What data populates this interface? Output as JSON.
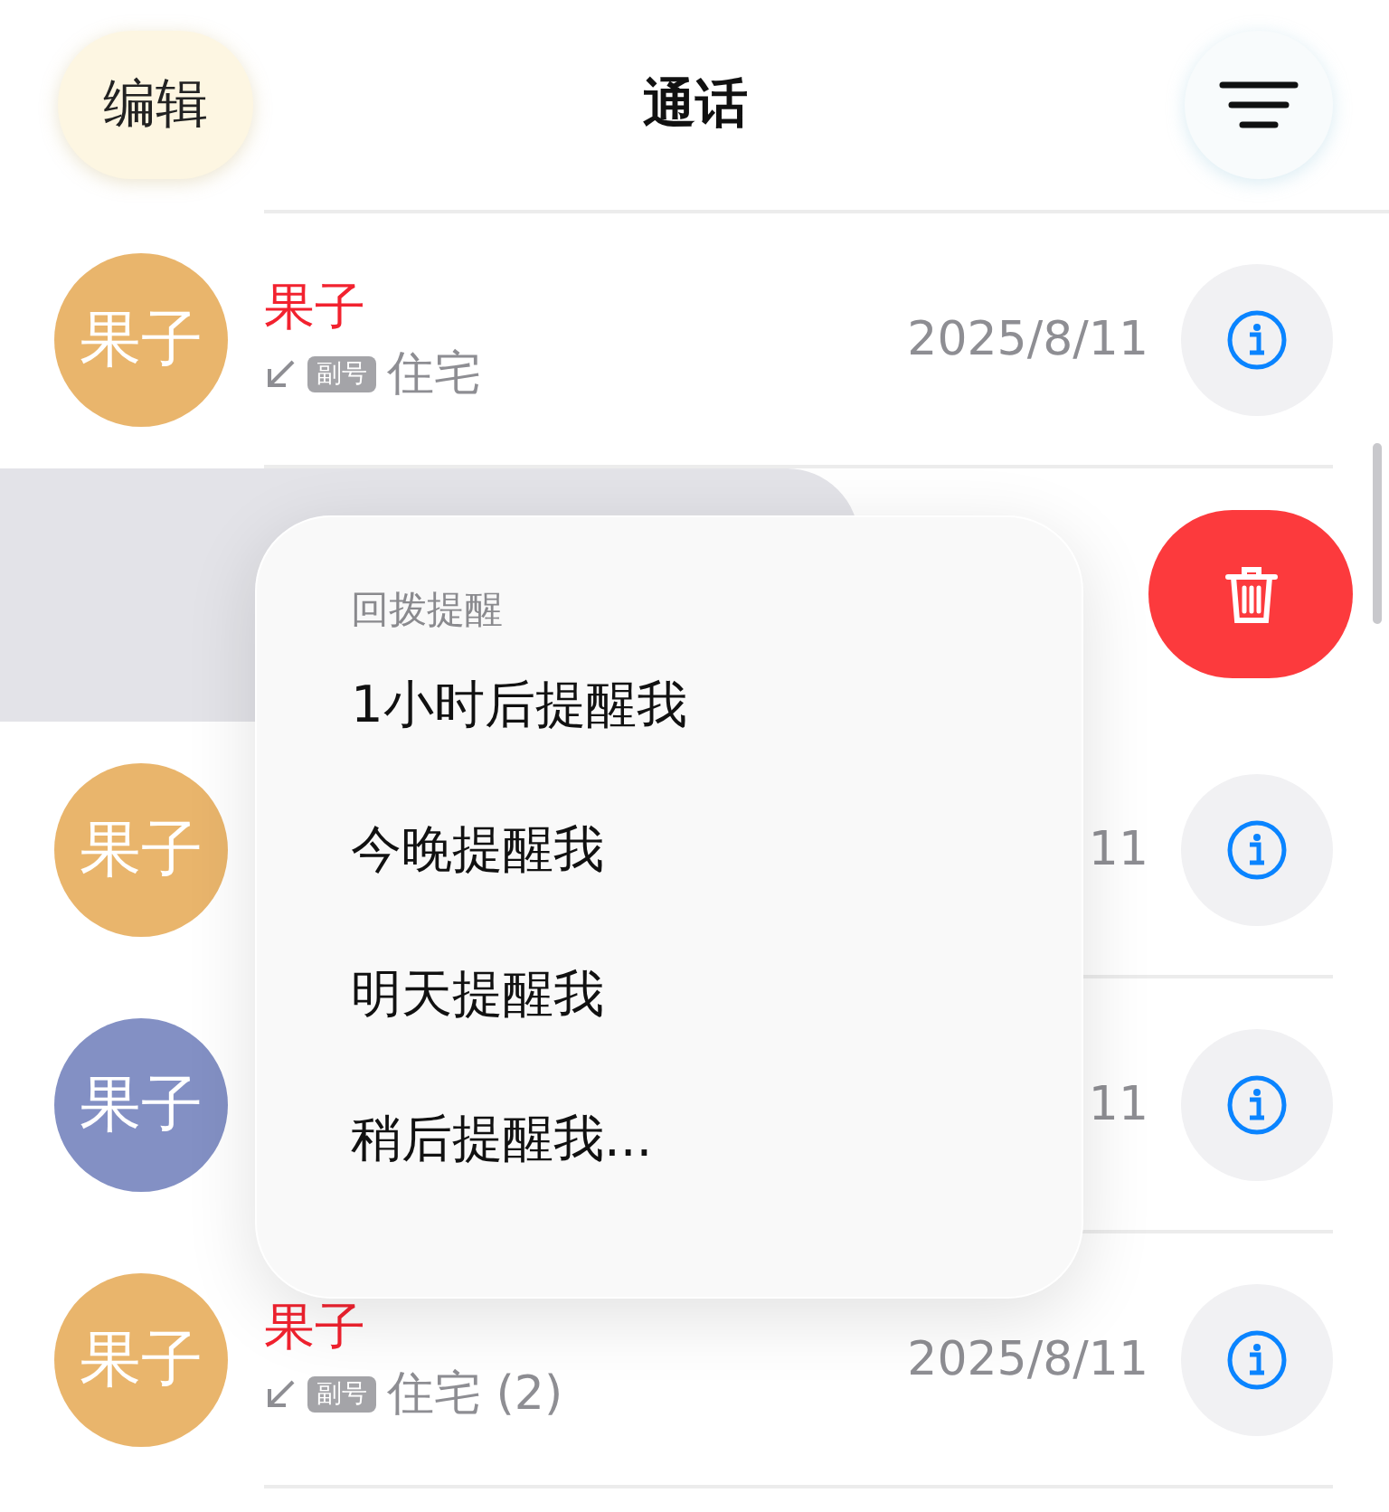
{
  "header": {
    "edit_button": "编辑",
    "title": "通话"
  },
  "calls": [
    {
      "kind": "full",
      "avatar": "果子",
      "color": "#e9b56c",
      "name": "果子",
      "tag": "副号",
      "label": "住宅",
      "date": "2025/8/11"
    },
    {
      "kind": "swiped"
    },
    {
      "kind": "covered",
      "avatar": "果子",
      "color": "#e9b56c",
      "date": "11"
    },
    {
      "kind": "covered",
      "avatar": "果子",
      "color": "#8390c4",
      "date": "11"
    },
    {
      "kind": "full",
      "avatar": "果子",
      "color": "#e9b56c",
      "name": "果子",
      "tag": "副号",
      "label": "住宅 (2)",
      "date": "2025/8/11"
    }
  ],
  "menu": {
    "title": "回拨提醒",
    "items": [
      "1小时后提醒我",
      "今晚提醒我",
      "明天提醒我",
      "稍后提醒我..."
    ]
  }
}
